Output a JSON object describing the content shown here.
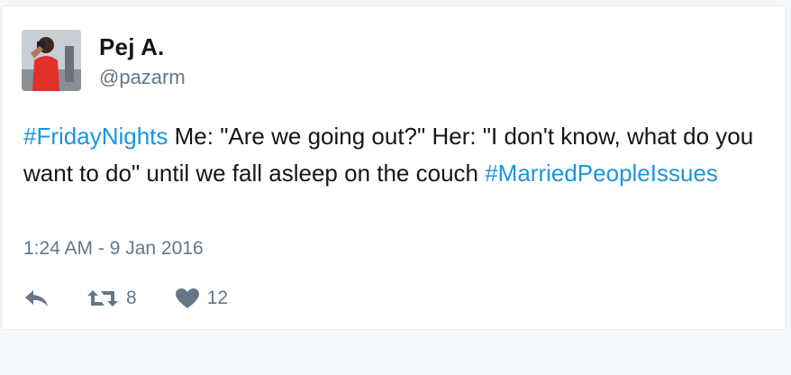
{
  "tweet": {
    "author": {
      "name": "Pej A.",
      "handle": "@pazarm"
    },
    "text": {
      "hashtag_1": "#FridayNights",
      "body": " Me: \"Are we going out?\" Her: \"I don't know, what do you want to do\" until we fall asleep on the couch ",
      "hashtag_2": "#MarriedPeopleIssues"
    },
    "timestamp": "1:24 AM - 9 Jan 2016",
    "actions": {
      "reply_icon": "reply-arrow-icon",
      "retweet_icon": "retweet-icon",
      "retweet_count": "8",
      "like_icon": "heart-icon",
      "like_count": "12"
    }
  },
  "colors": {
    "hashtag": "#1b95e0",
    "text": "#14171a",
    "secondary": "#657786",
    "card_background": "#ffffff",
    "page_background": "#f5f8fa"
  }
}
